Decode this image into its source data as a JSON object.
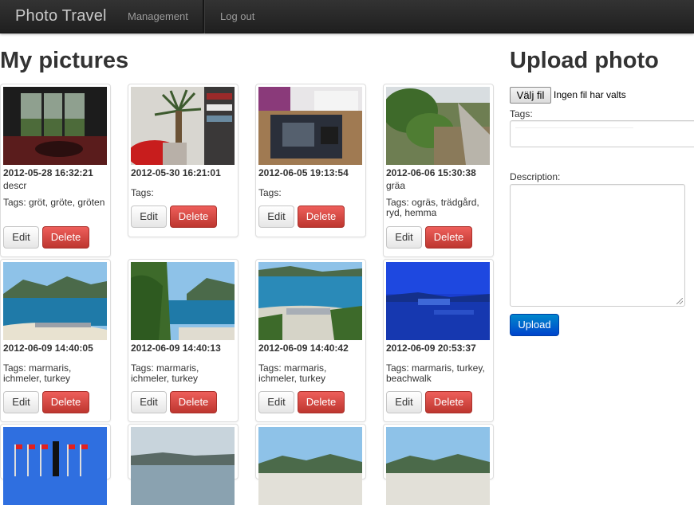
{
  "navbar": {
    "brand": "Photo Travel",
    "items": [
      "Management",
      "Log out"
    ]
  },
  "main": {
    "title": "My pictures",
    "edit_label": "Edit",
    "delete_label": "Delete",
    "pictures": [
      {
        "date": "2012-05-28 16:32:21",
        "description": "descr",
        "tags": "Tags: gröt, gröte, gröten"
      },
      {
        "date": "2012-05-30 16:21:01",
        "description": "",
        "tags": "Tags:"
      },
      {
        "date": "2012-06-05 19:13:54",
        "description": "",
        "tags": "Tags:"
      },
      {
        "date": "2012-06-06 15:30:38",
        "description": "gräa",
        "tags": "Tags: ogräs, trädgård, ryd, hemma"
      },
      {
        "date": "2012-06-09 14:40:05",
        "description": "",
        "tags": "Tags: marmaris, ichmeler, turkey"
      },
      {
        "date": "2012-06-09 14:40:13",
        "description": "",
        "tags": "Tags: marmaris, ichmeler, turkey"
      },
      {
        "date": "2012-06-09 14:40:42",
        "description": "",
        "tags": "Tags: marmaris, ichmeler, turkey"
      },
      {
        "date": "2012-06-09 20:53:37",
        "description": "",
        "tags": "Tags: marmaris, turkey, beachwalk"
      }
    ]
  },
  "upload": {
    "title": "Upload photo",
    "file_button": "Välj fil",
    "file_status": "Ingen fil har valts",
    "tags_label": "Tags:",
    "tags_value": "",
    "description_label": "Description:",
    "description_value": "",
    "submit_label": "Upload"
  },
  "colors": {
    "navbar": "#222222",
    "delete": "#da4f49",
    "primary": "#0074cc"
  }
}
